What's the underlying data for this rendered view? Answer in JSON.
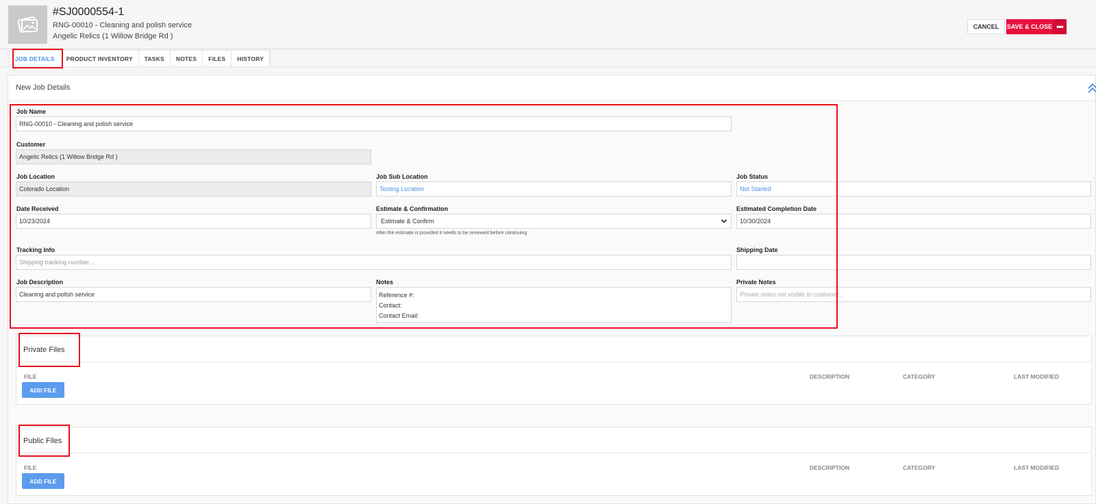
{
  "header": {
    "job_id": "#SJ0000554-1",
    "job_subtitle": "RNG-00010 - Cleaning and polish service",
    "customer_line": "Angelic Relics (1 Willow Bridge Rd )",
    "cancel_label": "CANCEL",
    "save_close_label": "SAVE & CLOSE",
    "more_label": "•••"
  },
  "tabs": [
    {
      "label": "JOB DETAILS",
      "active": true
    },
    {
      "label": "PRODUCT INVENTORY",
      "active": false
    },
    {
      "label": "TASKS",
      "active": false
    },
    {
      "label": "NOTES",
      "active": false
    },
    {
      "label": "FILES",
      "active": false
    },
    {
      "label": "HISTORY",
      "active": false
    }
  ],
  "panel": {
    "title": "New Job Details"
  },
  "form": {
    "job_name": {
      "label": "Job Name",
      "value": "RNG-00010 - Cleaning and polish service"
    },
    "customer": {
      "label": "Customer",
      "value": "Angelic Relics (1 Willow Bridge Rd )"
    },
    "job_location": {
      "label": "Job Location",
      "value": "Colorado Location"
    },
    "job_sub_location": {
      "label": "Job Sub Location",
      "value": "Testing Location"
    },
    "job_status": {
      "label": "Job Status",
      "value": "Not Started"
    },
    "date_received": {
      "label": "Date Received",
      "value": "10/23/2024"
    },
    "estimate": {
      "label": "Estimate & Confirmation",
      "value": "Estimate & Confirm",
      "hint": "After the estimate is provided it needs to be reviewed before continuing"
    },
    "est_completion": {
      "label": "Estimated Completion Date",
      "value": "10/30/2024"
    },
    "tracking": {
      "label": "Tracking Info",
      "placeholder": "Shipping tracking number..."
    },
    "shipping_date": {
      "label": "Shipping Date",
      "value": ""
    },
    "job_description": {
      "label": "Job Description",
      "value": "Cleaning and polish service"
    },
    "notes": {
      "label": "Notes",
      "lines": [
        "Reference #:",
        "Contact:",
        "Contact Email:"
      ]
    },
    "private_notes": {
      "label": "Private Notes",
      "placeholder": "Private notes not visible to customer..."
    }
  },
  "private_files": {
    "title": "Private Files",
    "columns": {
      "file": "FILE",
      "description": "DESCRIPTION",
      "category": "CATEGORY",
      "last_modified": "LAST MODIFIED"
    },
    "add_label": "ADD FILE"
  },
  "public_files": {
    "title": "Public Files",
    "columns": {
      "file": "FILE",
      "description": "DESCRIPTION",
      "category": "CATEGORY",
      "last_modified": "LAST MODIFIED"
    },
    "add_label": "ADD FILE"
  },
  "colors": {
    "accent_blue": "#4a90e2",
    "save_red": "#e8113c",
    "highlight_red": "#e8111b",
    "add_button_blue": "#5b9ced"
  },
  "icons": {
    "thumbnail": "image-placeholder-icon",
    "collapse": "double-chevron-up-icon",
    "select": "chevron-down-icon"
  }
}
